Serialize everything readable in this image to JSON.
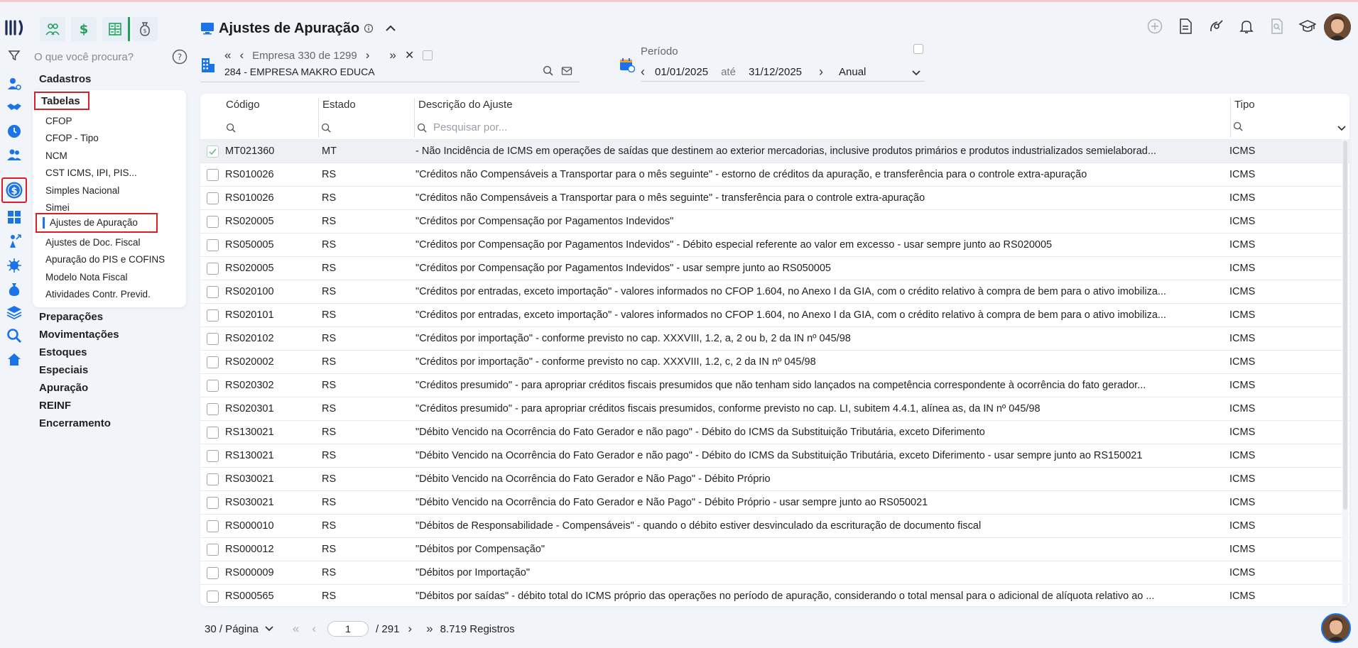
{
  "search": {
    "placeholder": "O que você procura?"
  },
  "nav": {
    "top_label": "Cadastros",
    "tabelas_label": "Tabelas",
    "tabelas_items": [
      "CFOP",
      "CFOP - Tipo",
      "NCM",
      "CST ICMS, IPI, PIS...",
      "Simples Nacional",
      "Simei"
    ],
    "selected_item": "Ajustes de Apuração",
    "tabelas_items_after": [
      "Ajustes de Doc. Fiscal",
      "Apuração do PIS e COFINS",
      "Modelo Nota Fiscal",
      "Atividades Contr. Previd."
    ],
    "groups": [
      "Preparações",
      "Movimentações",
      "Estoques",
      "Especiais",
      "Apuração",
      "REINF",
      "Encerramento"
    ]
  },
  "header": {
    "title": "Ajustes de Apuração"
  },
  "company": {
    "nav_label": "Empresa 330 de 1299",
    "name": "284 - EMPRESA MAKRO EDUCA"
  },
  "period": {
    "label": "Período",
    "start": "01/01/2025",
    "ate": "até",
    "end": "31/12/2025",
    "mode": "Anual"
  },
  "table": {
    "columns": [
      "Código",
      "Estado",
      "Descrição do Ajuste",
      "Tipo"
    ],
    "search_placeholder": "Pesquisar por...",
    "rows": [
      [
        "MT021360",
        "MT",
        "- Não Incidência de ICMS em operações de saídas que destinem ao exterior mercadorias, inclusive produtos primários e produtos industrializados semielaborad...",
        "ICMS"
      ],
      [
        "RS010026",
        "RS",
        "\"Créditos não Compensáveis a Transportar para o mês seguinte\" - estorno de créditos da apuração, e transferência para o controle extra-apuração",
        "ICMS"
      ],
      [
        "RS010026",
        "RS",
        "\"Créditos não Compensáveis a Transportar para o mês seguinte\" - transferência para o controle extra-apuração",
        "ICMS"
      ],
      [
        "RS020005",
        "RS",
        "\"Créditos por Compensação por Pagamentos Indevidos\"",
        "ICMS"
      ],
      [
        "RS050005",
        "RS",
        "\"Créditos por Compensação por Pagamentos Indevidos\" - Débito especial referente ao valor em excesso - usar sempre junto ao RS020005",
        "ICMS"
      ],
      [
        "RS020005",
        "RS",
        "\"Créditos por Compensação por Pagamentos Indevidos\" - usar sempre junto ao RS050005",
        "ICMS"
      ],
      [
        "RS020100",
        "RS",
        "\"Créditos por entradas, exceto importação\" - valores informados no CFOP 1.604, no Anexo I da GIA, com o crédito relativo à compra de bem para o ativo imobiliza...",
        "ICMS"
      ],
      [
        "RS020101",
        "RS",
        "\"Créditos por entradas, exceto importação\" - valores informados no CFOP 1.604, no Anexo I da GIA, com o crédito relativo à compra de bem para o ativo imobiliza...",
        "ICMS"
      ],
      [
        "RS020102",
        "RS",
        "\"Créditos por importação\" - conforme previsto no cap. XXXVIII, 1.2, a, 2 ou b, 2 da IN nº 045/98",
        "ICMS"
      ],
      [
        "RS020002",
        "RS",
        "\"Créditos por importação\" - conforme previsto no cap. XXXVIII, 1.2, c, 2 da IN nº 045/98",
        "ICMS"
      ],
      [
        "RS020302",
        "RS",
        "\"Créditos presumido\" - para apropriar créditos fiscais presumidos que não tenham sido lançados na competência correspondente à ocorrência do fato gerador...",
        "ICMS"
      ],
      [
        "RS020301",
        "RS",
        "\"Créditos presumido\" - para apropriar créditos fiscais presumidos, conforme previsto no cap. LI, subitem 4.4.1, alínea as, da IN nº 045/98",
        "ICMS"
      ],
      [
        "RS130021",
        "RS",
        "\"Débito Vencido na Ocorrência do Fato Gerador e não pago\" - Débito do ICMS da Substituição Tributária, exceto Diferimento",
        "ICMS"
      ],
      [
        "RS130021",
        "RS",
        "\"Débito Vencido na Ocorrência do Fato Gerador e não pago\" - Débito do ICMS da Substituição Tributária, exceto Diferimento - usar sempre junto ao RS150021",
        "ICMS"
      ],
      [
        "RS030021",
        "RS",
        "\"Débito Vencido na Ocorrência do Fato Gerador e Não Pago\" - Débito Próprio",
        "ICMS"
      ],
      [
        "RS030021",
        "RS",
        "\"Débito Vencido na Ocorrência do Fato Gerador e Não Pago\" - Débito Próprio - usar sempre junto ao RS050021",
        "ICMS"
      ],
      [
        "RS000010",
        "RS",
        "\"Débitos de Responsabilidade - Compensáveis\" - quando o débito estiver desvinculado da escrituração de documento fiscal",
        "ICMS"
      ],
      [
        "RS000012",
        "RS",
        "\"Débitos por Compensação\"",
        "ICMS"
      ],
      [
        "RS000009",
        "RS",
        "\"Débitos por Importação\"",
        "ICMS"
      ],
      [
        "RS000565",
        "RS",
        "\"Débitos por saídas\" - débito total do ICMS próprio das operações no período de apuração, considerando o total mensal para o adicional de alíquota relativo ao ...",
        "ICMS"
      ]
    ]
  },
  "pager": {
    "per_page": "30 / Página",
    "current": "1",
    "total": "/ 291",
    "records": "8.719 Registros"
  },
  "colors": {
    "accent": "#1a73e8",
    "highlight": "#d81f26",
    "green": "#21a05b"
  }
}
